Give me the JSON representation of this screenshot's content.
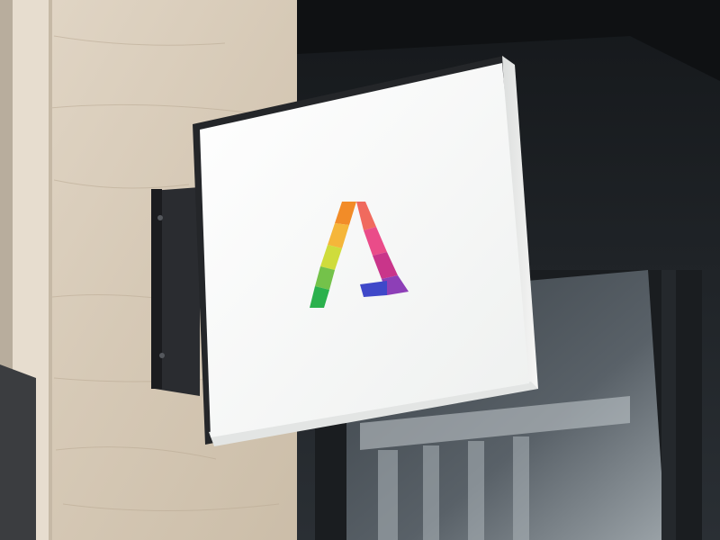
{
  "scene": {
    "subject": "wall-mounted-square-sign",
    "logo_icon": "letter-a-logo-icon",
    "colors": {
      "wall_stone": "#d9cdbc",
      "wall_vein": "#b9a993",
      "pilaster": "#e7ddcf",
      "storefront_dark": "#1e2226",
      "window_glass": "#2e3439",
      "reflection": "#8c959b",
      "bracket": "#2a2c30",
      "sign_face": "#fbfbfa",
      "sign_frame": "#242629"
    },
    "logo_colors": [
      "#f28c28",
      "#f5b63a",
      "#cfdc3c",
      "#74c24a",
      "#2bb14d",
      "#ea4c89",
      "#c9358a",
      "#8d3fb7",
      "#3f48c9"
    ]
  }
}
